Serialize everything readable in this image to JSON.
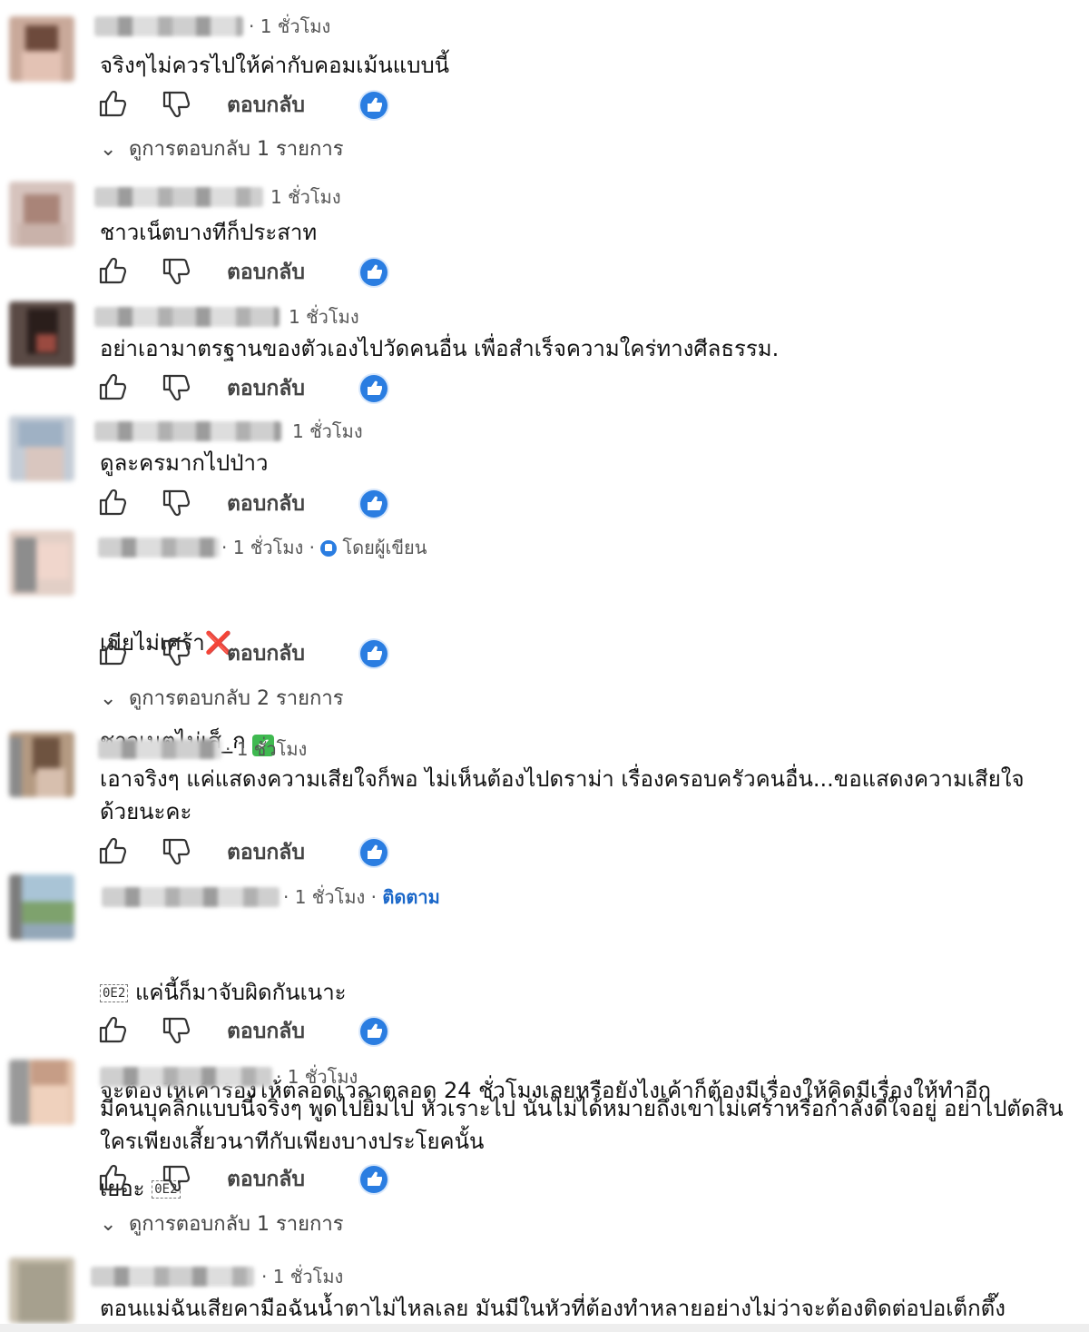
{
  "actions": {
    "reply_label": "ตอบกลับ",
    "like_icon": "thumbs-up-icon",
    "dislike_icon": "thumbs-down-icon",
    "creator_like_icon": "creator-heart-icon"
  },
  "comments": [
    {
      "time": "· 1 ชั่วโมง",
      "text": "จริงๆไม่ควรไปให้ค่ากับคอมเม้นแบบนี้",
      "replies": "ดูการตอบกลับ 1 รายการ"
    },
    {
      "time": "1 ชั่วโมง",
      "text": "ชาวเน็ตบางทีก็ประสาท"
    },
    {
      "time": "1 ชั่วโมง",
      "text": "อย่าเอามาตรฐานของตัวเองไปวัดคนอื่น เพื่อสำเร็จความใคร่ทางศีลธรรม."
    },
    {
      "time": "1 ชั่วโมง",
      "text": "ดูละครมากไปป่าว"
    },
    {
      "time": "· 1 ชั่วโมง ·",
      "author_badge": "โดยผู้เขียน",
      "line1": "เมียไม่เศร้า",
      "line1_emoji": "❌",
      "line2": "ชาวเนตไม่เส็_ก",
      "line2_emoji": "✔",
      "replies": "ดูการตอบกลับ 2 รายการ"
    },
    {
      "time": "· 1 ชั่วโมง",
      "text": "เอาจริงๆ แค่แสดงความเสียใจก็พอ ไม่เห็นต้องไปดราม่า เรื่องครอบครัวคนอื่น...ขอแสดงความเสียใจด้วยนะคะ"
    },
    {
      "time": "· 1 ชั่วโมง ·",
      "follow": "ติดตาม",
      "glyph": "0E2",
      "line1": "แค่นี้ก็มาจับผิดกันเนาะ",
      "line2": "จะต้องให้เค้าร้องไห้ตลอดเวลาตลอด 24 ชั่วโมงเลยหรือยังไงเค้าก็ต้องมีเรื่องให้คิดมีเรื่องให้ทำอีก",
      "line3": "เยอะ"
    },
    {
      "time": "· 1 ชั่วโมง",
      "text": "มีคนบุคลิกแบบนี้จริงๆ พูดไปยิ้มไป หัวเราะไป นั่นไม่ได้หมายถึงเขาไม่เศร้าหรือกำลังดีใจอยู่ อย่าไปตัดสินใครเพียงเสี้ยวนาทีกับเพียงบางประโยคนั้น",
      "replies": "ดูการตอบกลับ 1 รายการ"
    },
    {
      "time": "· 1 ชั่วโมง",
      "text": "ตอนแม่ฉันเสียคามือฉันน้ำตาไม่ไหลเลย มันมีในหัวที่ต้องทำหลายอย่างไม่ว่าจะต้องติดต่อปอเต็กตึ๊ง"
    }
  ]
}
